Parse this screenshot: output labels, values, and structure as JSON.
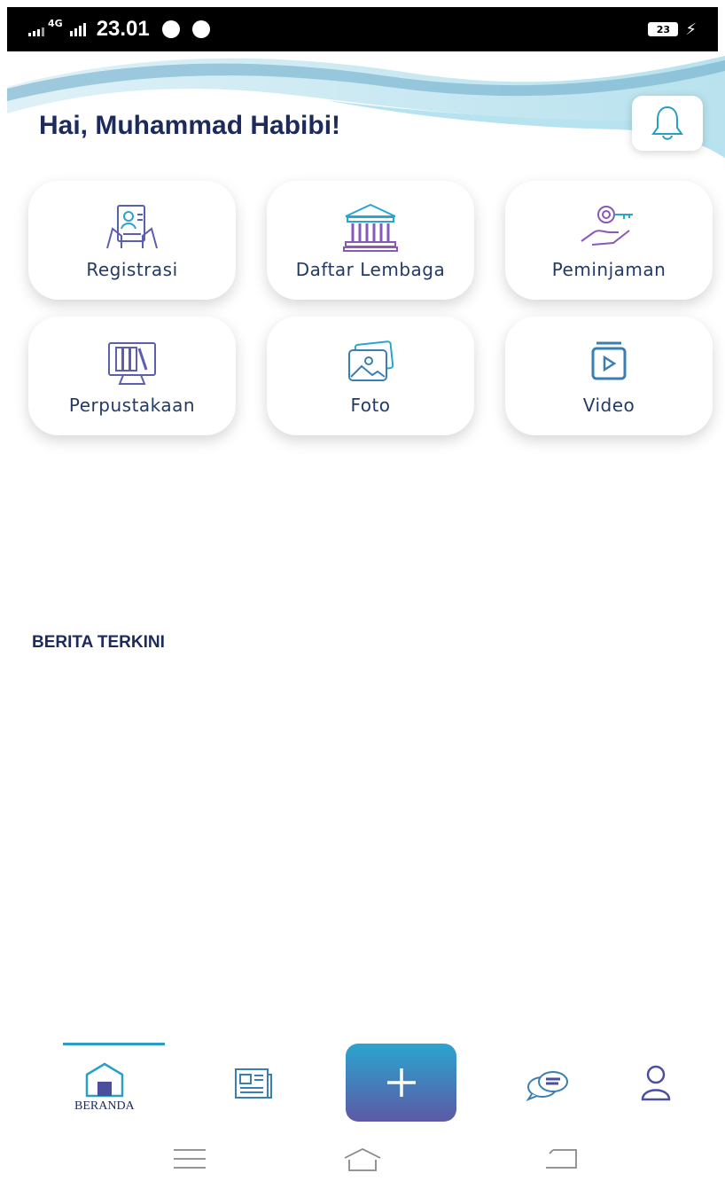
{
  "status_bar": {
    "network": "4G",
    "time": "23.01",
    "battery": "23"
  },
  "greeting": "Hai, Muhammad Habibi!",
  "menu": [
    {
      "label": "Registrasi",
      "icon": "registration-icon"
    },
    {
      "label": "Daftar Lembaga",
      "icon": "institution-icon"
    },
    {
      "label": "Peminjaman",
      "icon": "loan-icon"
    },
    {
      "label": "Perpustakaan",
      "icon": "library-icon"
    },
    {
      "label": "Foto",
      "icon": "photo-icon"
    },
    {
      "label": "Video",
      "icon": "video-icon"
    }
  ],
  "section": {
    "title": "BERITA TERKINI"
  },
  "bottom_nav": {
    "active_label": "BERANDA",
    "items": [
      "home-icon",
      "news-icon",
      "add-icon",
      "chat-icon",
      "profile-icon"
    ]
  },
  "colors": {
    "accent": "#2aa5cf",
    "gradient_end": "#5d59a6",
    "text": "#1c2a5c"
  }
}
